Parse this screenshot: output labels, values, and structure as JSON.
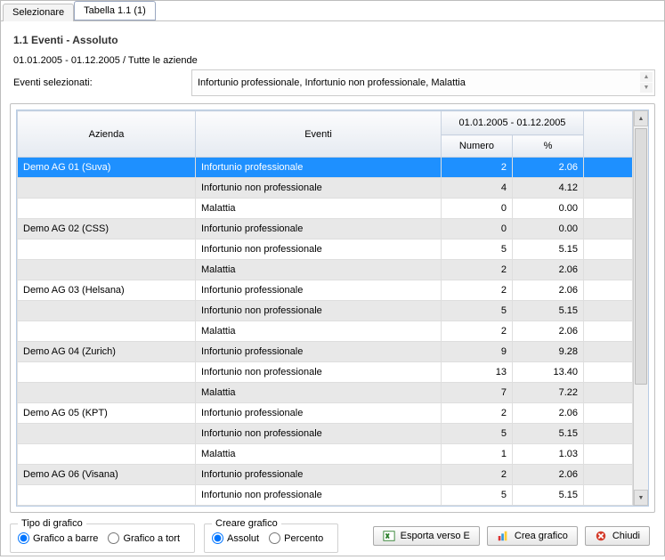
{
  "tabs": {
    "select": "Selezionare",
    "active": "Tabella 1.1 (1)"
  },
  "title": "1.1 Eventi - Assoluto",
  "date_line": "01.01.2005 - 01.12.2005 / Tutte le aziende",
  "filter": {
    "label": "Eventi selezionati:",
    "value": "Infortunio professionale, Infortunio non professionale, Malattia"
  },
  "columns": {
    "azienda": "Azienda",
    "eventi": "Eventi",
    "period": "01.01.2005 - 01.12.2005",
    "numero": "Numero",
    "percent": "%"
  },
  "rows": [
    {
      "az": "Demo AG 01 (Suva)",
      "ev": "Infortunio professionale",
      "n": "2",
      "p": "2.06",
      "sel": true,
      "alt": false
    },
    {
      "az": "",
      "ev": "Infortunio non professionale",
      "n": "4",
      "p": "4.12",
      "alt": true
    },
    {
      "az": "",
      "ev": "Malattia",
      "n": "0",
      "p": "0.00",
      "alt": false
    },
    {
      "az": "Demo AG 02 (CSS)",
      "ev": "Infortunio professionale",
      "n": "0",
      "p": "0.00",
      "alt": true
    },
    {
      "az": "",
      "ev": "Infortunio non professionale",
      "n": "5",
      "p": "5.15",
      "alt": false
    },
    {
      "az": "",
      "ev": "Malattia",
      "n": "2",
      "p": "2.06",
      "alt": true
    },
    {
      "az": "Demo AG 03 (Helsana)",
      "ev": "Infortunio professionale",
      "n": "2",
      "p": "2.06",
      "alt": false
    },
    {
      "az": "",
      "ev": "Infortunio non professionale",
      "n": "5",
      "p": "5.15",
      "alt": true
    },
    {
      "az": "",
      "ev": "Malattia",
      "n": "2",
      "p": "2.06",
      "alt": false
    },
    {
      "az": "Demo AG 04 (Zurich)",
      "ev": "Infortunio professionale",
      "n": "9",
      "p": "9.28",
      "alt": true
    },
    {
      "az": "",
      "ev": "Infortunio non professionale",
      "n": "13",
      "p": "13.40",
      "alt": false
    },
    {
      "az": "",
      "ev": "Malattia",
      "n": "7",
      "p": "7.22",
      "alt": true
    },
    {
      "az": "Demo AG 05 (KPT)",
      "ev": "Infortunio professionale",
      "n": "2",
      "p": "2.06",
      "alt": false
    },
    {
      "az": "",
      "ev": "Infortunio non professionale",
      "n": "5",
      "p": "5.15",
      "alt": true
    },
    {
      "az": "",
      "ev": "Malattia",
      "n": "1",
      "p": "1.03",
      "alt": false
    },
    {
      "az": "Demo AG 06 (Visana)",
      "ev": "Infortunio professionale",
      "n": "2",
      "p": "2.06",
      "alt": true
    },
    {
      "az": "",
      "ev": "Infortunio non professionale",
      "n": "5",
      "p": "5.15",
      "alt": false
    }
  ],
  "groupbox": {
    "chart_type_title": "Tipo di grafico",
    "radio_bar": "Grafico a barre",
    "radio_pie": "Grafico a tort",
    "create_title": "Creare grafico",
    "radio_absolute": "Assolut",
    "radio_percent": "Percento"
  },
  "buttons": {
    "export": "Esporta verso E",
    "chart": "Crea grafico",
    "close": "Chiudi"
  }
}
